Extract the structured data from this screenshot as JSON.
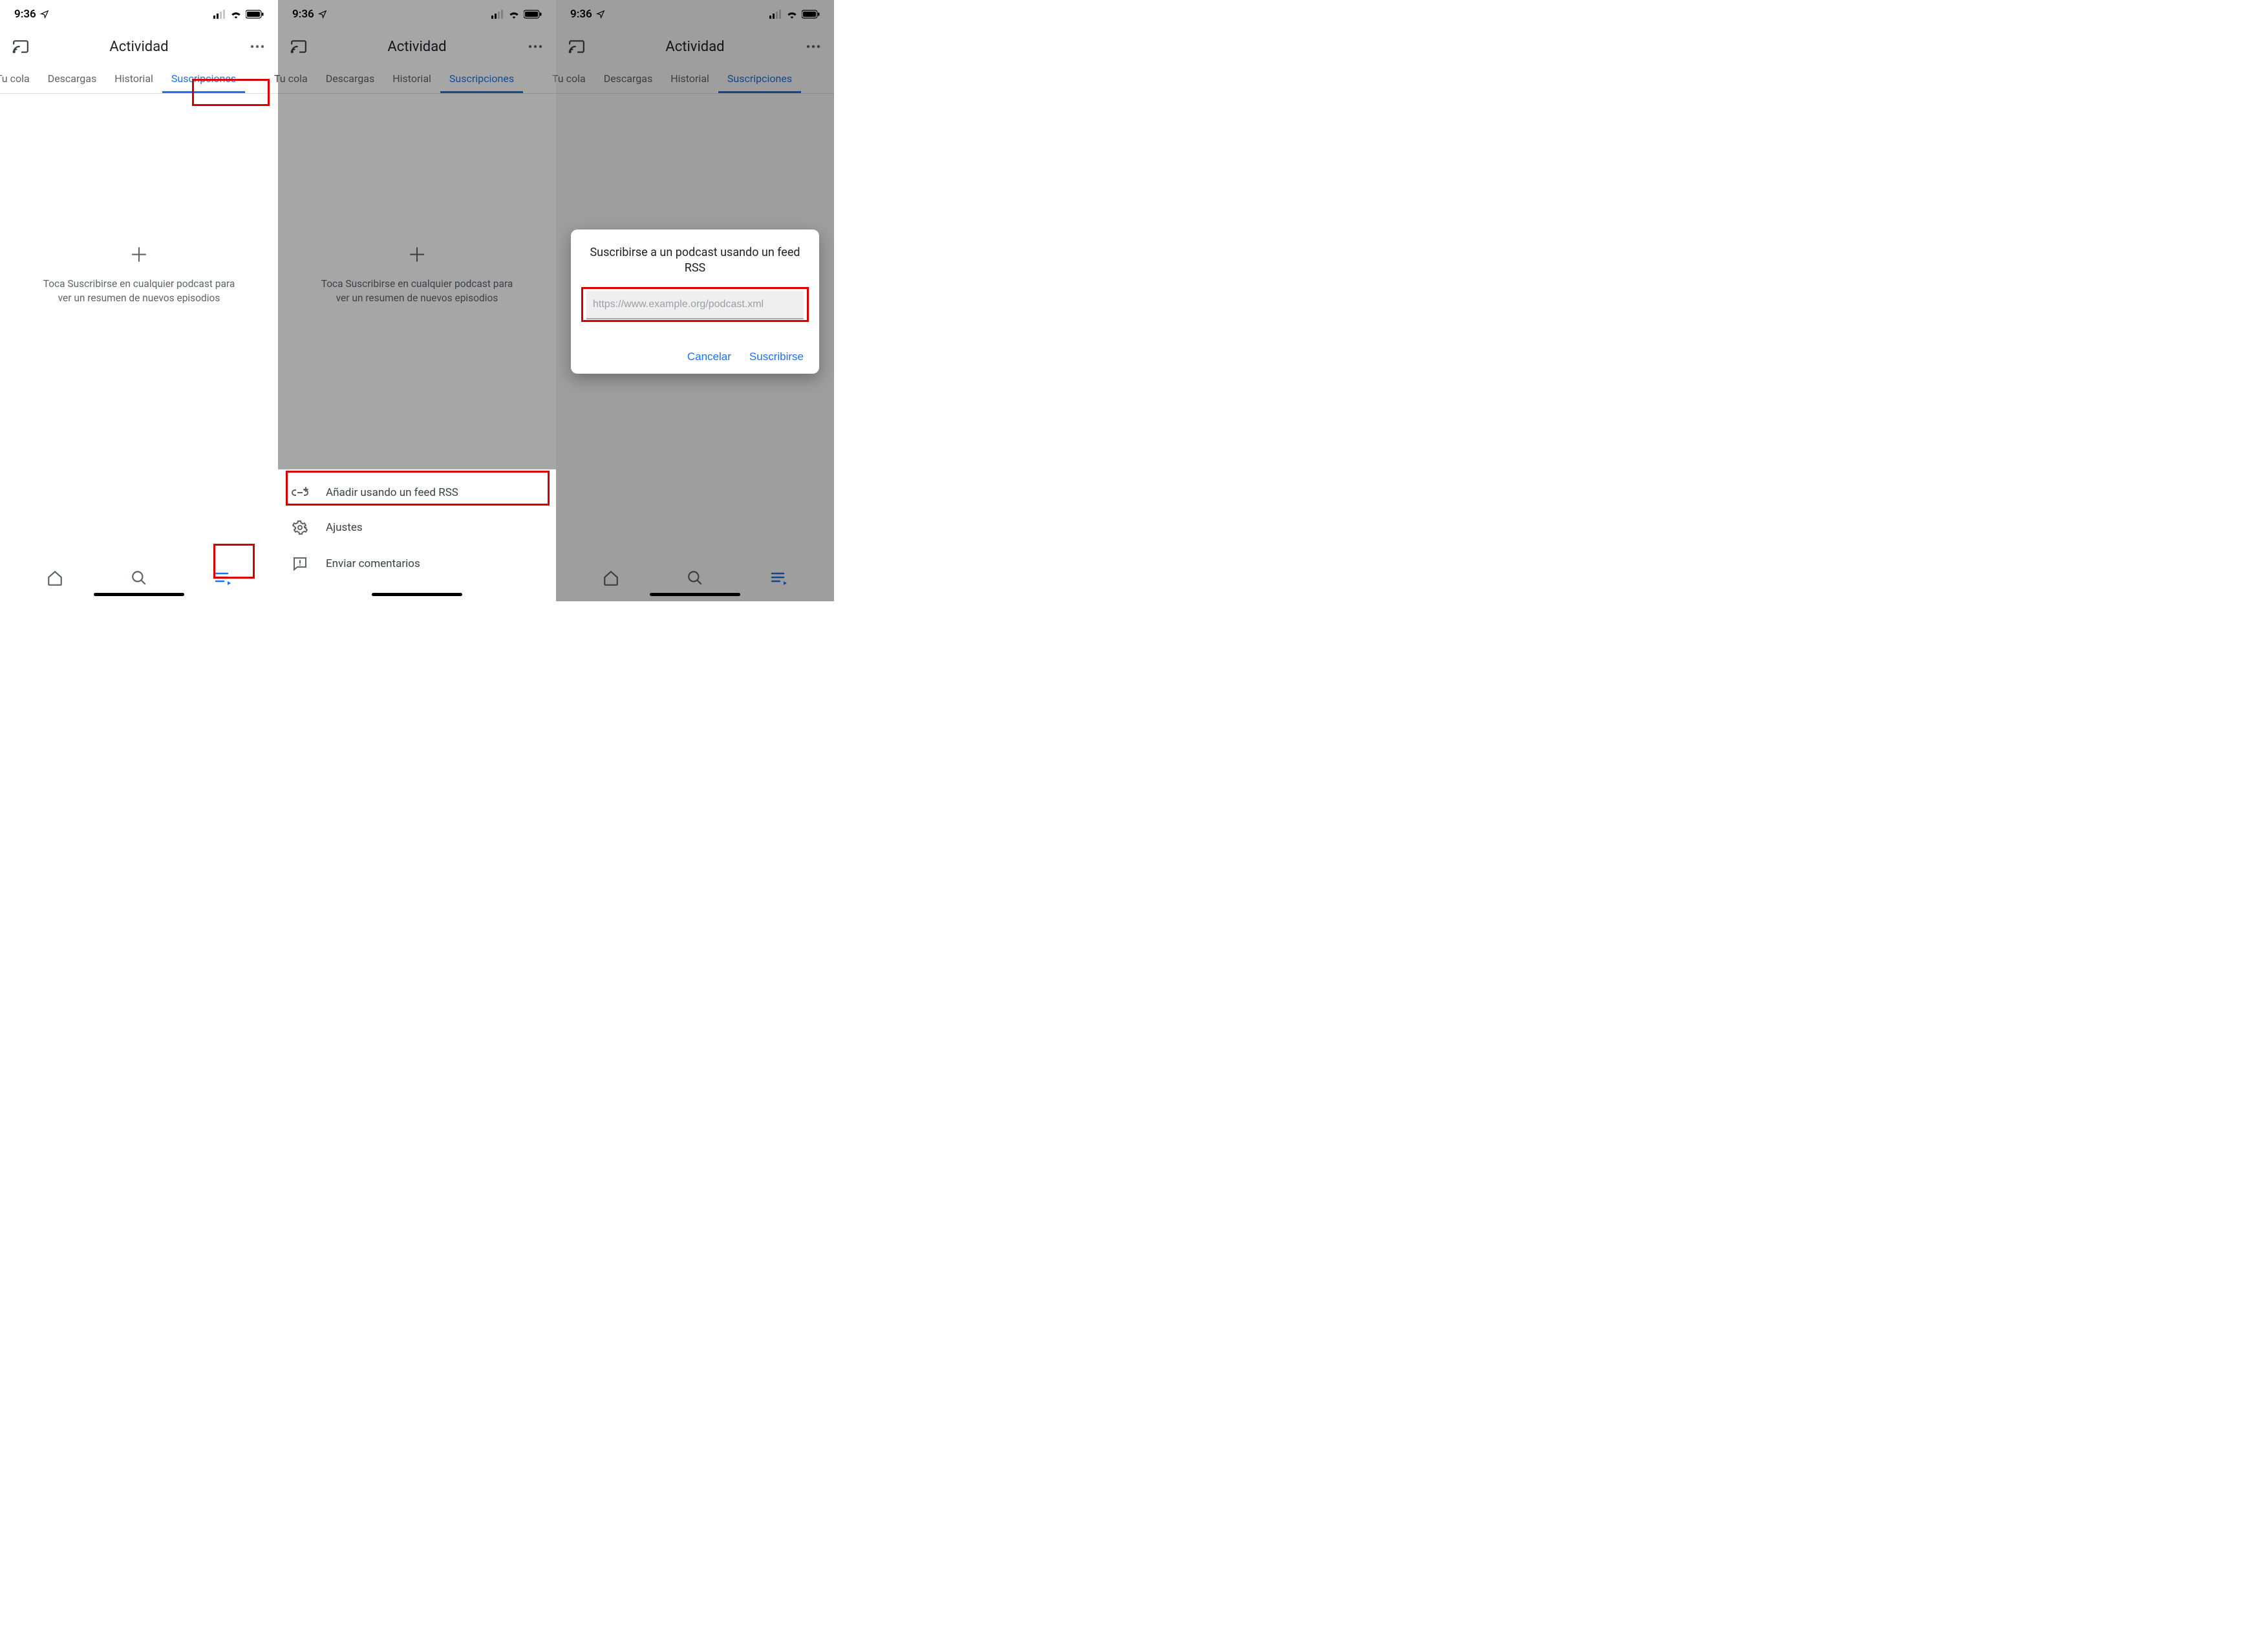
{
  "status": {
    "time": "9:36"
  },
  "header": {
    "title": "Actividad"
  },
  "tabs": [
    {
      "label": "Tu cola",
      "active": false
    },
    {
      "label": "Descargas",
      "active": false
    },
    {
      "label": "Historial",
      "active": false
    },
    {
      "label": "Suscripciones",
      "active": true
    }
  ],
  "empty_state": {
    "line1": "Toca Suscribirse en cualquier podcast para",
    "line2": "ver un resumen de nuevos episodios"
  },
  "sheet": {
    "add_rss": "Añadir usando un feed RSS",
    "settings": "Ajustes",
    "feedback": "Enviar comentarios"
  },
  "dialog": {
    "title": "Suscribirse a un podcast usando un feed RSS",
    "placeholder": "https://www.example.org/podcast.xml",
    "cancel": "Cancelar",
    "subscribe": "Suscribirse"
  }
}
